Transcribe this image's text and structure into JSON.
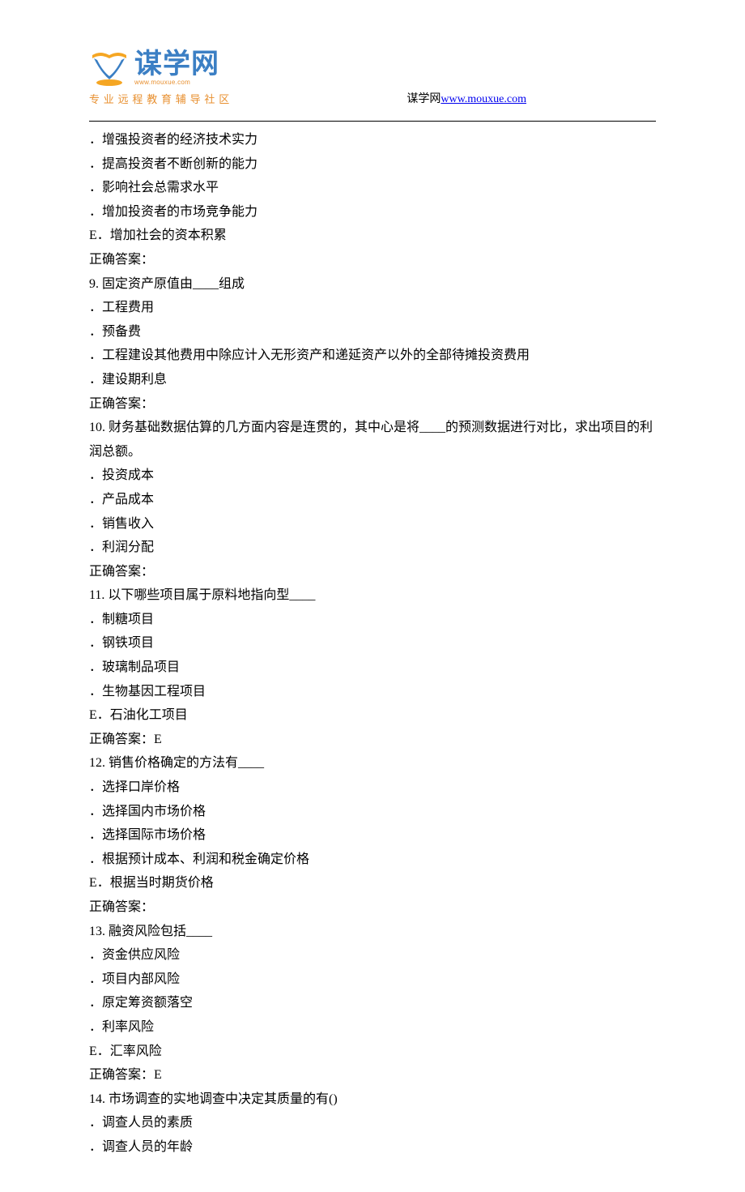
{
  "header": {
    "logo_text": "谋学网",
    "logo_url_text": "www.mouxue.com",
    "logo_subtitle": "专业远程教育辅导社区",
    "site_label": "谋学网",
    "site_url": "www.mouxue.com"
  },
  "lines": [
    "．增强投资者的经济技术实力",
    "．提高投资者不断创新的能力",
    "．影响社会总需求水平",
    "．增加投资者的市场竞争能力",
    "E．增加社会的资本积累",
    "正确答案：",
    "9.   固定资产原值由____组成",
    "．工程费用",
    "．预备费",
    "．工程建设其他费用中除应计入无形资产和递延资产以外的全部待摊投资费用",
    "．建设期利息",
    "正确答案：",
    "10.   财务基础数据估算的几方面内容是连贯的，其中心是将____的预测数据进行对比，求出项目的利润总额。",
    "．投资成本",
    "．产品成本",
    "．销售收入",
    "．利润分配",
    "正确答案：",
    "11.   以下哪些项目属于原料地指向型____",
    "．制糖项目",
    "．钢铁项目",
    "．玻璃制品项目",
    "．生物基因工程项目",
    "E．石油化工项目",
    "正确答案：E",
    "12.   销售价格确定的方法有____",
    "．选择口岸价格",
    "．选择国内市场价格",
    "．选择国际市场价格",
    "．根据预计成本、利润和税金确定价格",
    "E．根据当时期货价格",
    "正确答案：",
    "13.   融资风险包括____",
    "．资金供应风险",
    "．项目内部风险",
    "．原定筹资额落空",
    "．利率风险",
    "E．汇率风险",
    "正确答案：E",
    "14.   市场调查的实地调查中决定其质量的有()",
    "．调查人员的素质",
    "．调查人员的年龄"
  ]
}
